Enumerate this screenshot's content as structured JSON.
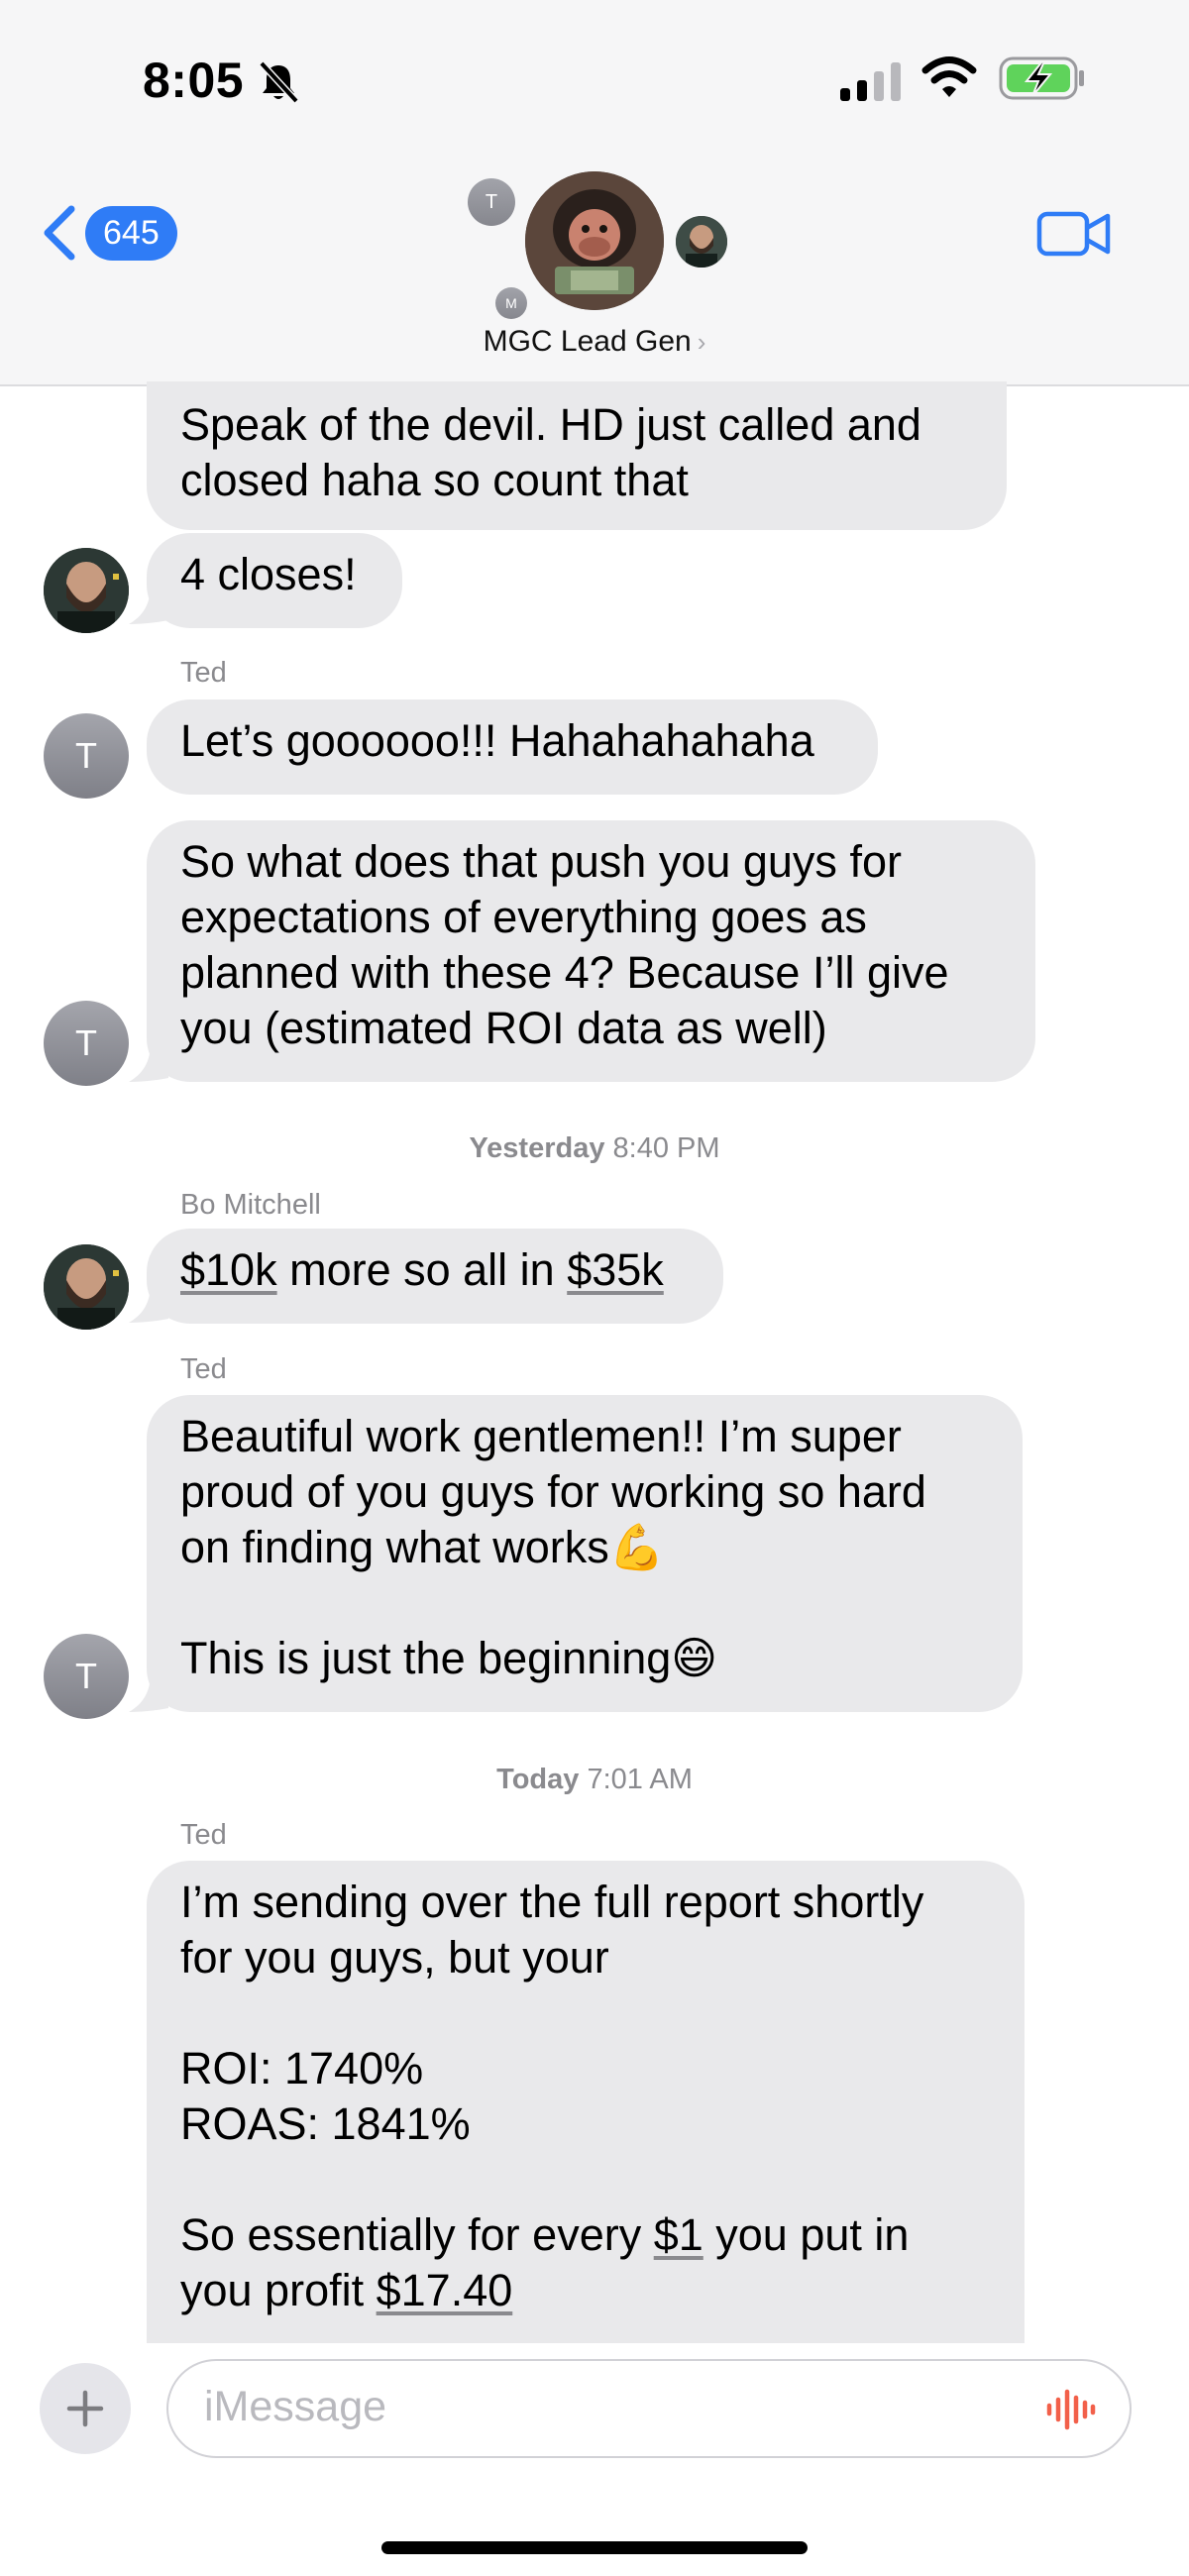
{
  "status_bar": {
    "time": "8:05"
  },
  "header": {
    "back_count": "645",
    "group_name": "MGC Lead Gen",
    "mini_avatar_top": "T",
    "mini_avatar_bottom": "M"
  },
  "messages": [
    {
      "text": "Speak of the devil. HD just called and\nclosed haha so count that"
    },
    {
      "text": "4 closes!"
    },
    {
      "sender": "Ted"
    },
    {
      "text": "Let’s goooooo!!! Hahahahahaha"
    },
    {
      "text": "So what does that push you guys for\nexpectations of everything goes as\nplanned with these 4? Because I’ll give\nyou (estimated ROI data as well)"
    },
    {
      "stamp_day": "Yesterday",
      "stamp_time": "8:40 PM"
    },
    {
      "sender": "Bo Mitchell"
    },
    {
      "p1": "$10k",
      "p2": " more so all in ",
      "p3": "$35k"
    },
    {
      "sender": "Ted"
    },
    {
      "text": "Beautiful work gentlemen!! I’m super\nproud of you guys for working so hard\non finding what works💪\n\nThis is just the beginning😄"
    },
    {
      "stamp_day": "Today",
      "stamp_time": "7:01 AM"
    },
    {
      "sender": "Ted"
    },
    {
      "text": "I’m sending over the full report shortly\nfor you guys, but your\n\nROI: 1740%\nROAS: 1841%\n\n",
      "p1": "So essentially for every ",
      "p2": "$1",
      "p3": " you put in\nyou profit ",
      "p4": "$17.40"
    }
  ],
  "avatar_letter": "T",
  "composer": {
    "placeholder": "iMessage"
  },
  "colors": {
    "accent": "#2f7cf6",
    "bubble": "#e9e9eb",
    "mic": "#f2604a"
  }
}
